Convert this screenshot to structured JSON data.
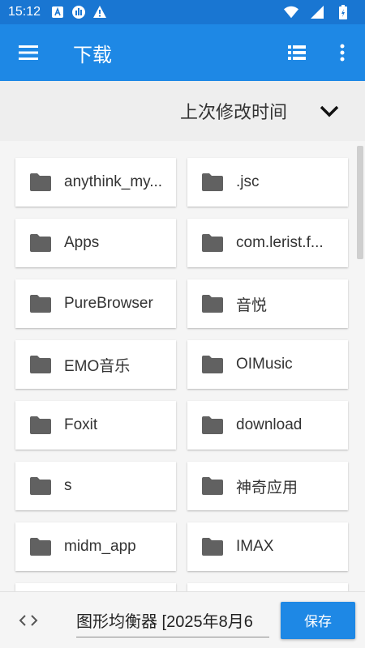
{
  "status_bar": {
    "time": "15:12",
    "icons": [
      "a-notification-icon",
      "podcast-icon",
      "warning-icon"
    ],
    "right_icons": [
      "wifi-icon",
      "signal-icon",
      "battery-icon"
    ]
  },
  "app_bar": {
    "title": "下载",
    "menu_icon": "hamburger-menu-icon",
    "actions": [
      "list-view-icon",
      "more-vert-icon"
    ]
  },
  "sort": {
    "label": "上次修改时间",
    "icon": "chevron-down-icon"
  },
  "folders": [
    {
      "name": "anythink_my..."
    },
    {
      "name": ".jsc"
    },
    {
      "name": "Apps"
    },
    {
      "name": "com.lerist.f..."
    },
    {
      "name": "PureBrowser"
    },
    {
      "name": "音悦"
    },
    {
      "name": "EMO音乐"
    },
    {
      "name": "OIMusic"
    },
    {
      "name": "Foxit"
    },
    {
      "name": "download"
    },
    {
      "name": "s"
    },
    {
      "name": "神奇应用"
    },
    {
      "name": "midm_app"
    },
    {
      "name": "IMAX"
    },
    {
      "name": ""
    },
    {
      "name": ""
    }
  ],
  "bottom_bar": {
    "code_icon": "code-brackets-icon",
    "filename_value": "图形均衡器 [2025年8月6",
    "save_label": "保存"
  },
  "colors": {
    "status_bar": "#1976d2",
    "app_bar": "#1e88e5",
    "folder_icon": "#616161",
    "save_button": "#1e88e5"
  }
}
